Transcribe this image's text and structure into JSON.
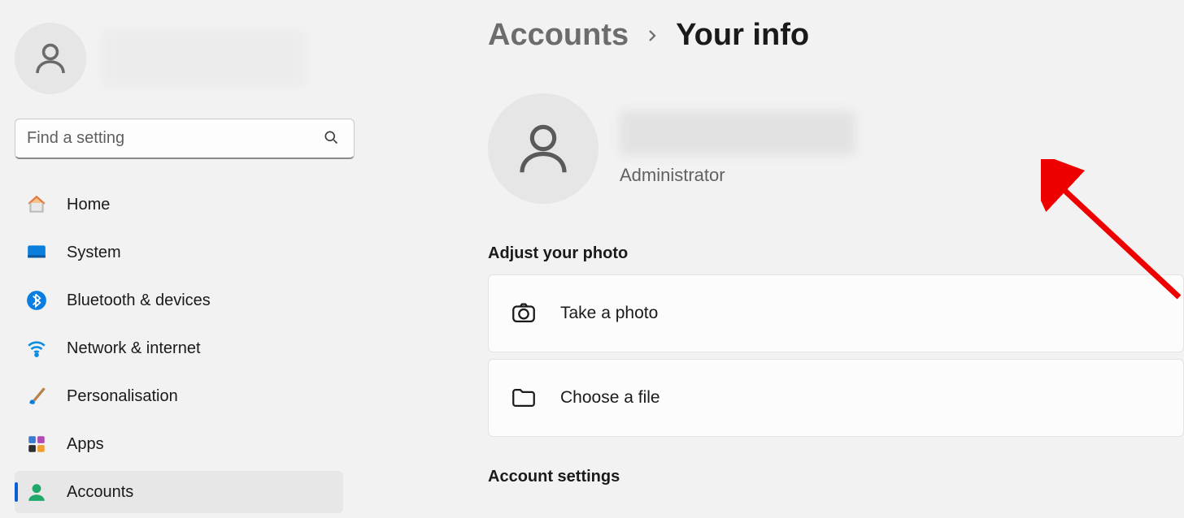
{
  "sidebar": {
    "search_placeholder": "Find a setting",
    "items": [
      {
        "id": "home",
        "label": "Home"
      },
      {
        "id": "system",
        "label": "System"
      },
      {
        "id": "bluetooth",
        "label": "Bluetooth & devices"
      },
      {
        "id": "network",
        "label": "Network & internet"
      },
      {
        "id": "personalisation",
        "label": "Personalisation"
      },
      {
        "id": "apps",
        "label": "Apps"
      },
      {
        "id": "accounts",
        "label": "Accounts"
      }
    ],
    "active": "accounts"
  },
  "breadcrumb": {
    "parent": "Accounts",
    "current": "Your info"
  },
  "user": {
    "role": "Administrator"
  },
  "photo_section": {
    "header": "Adjust your photo",
    "take_photo": "Take a photo",
    "choose_file": "Choose a file"
  },
  "account_settings_header": "Account settings"
}
